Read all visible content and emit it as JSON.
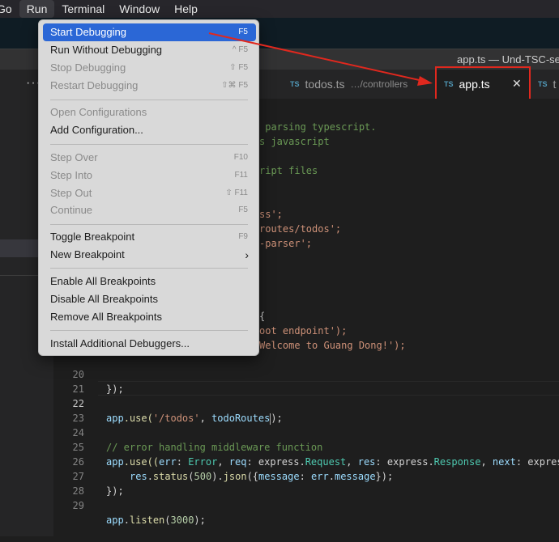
{
  "menubar": {
    "items": [
      "Go",
      "Run",
      "Terminal",
      "Window",
      "Help"
    ],
    "active": "Run"
  },
  "window": {
    "title": "app.ts — Und-TSC-sec"
  },
  "tabs": {
    "todos": {
      "icon": "TS",
      "label": "todos.ts",
      "path": "…/controllers"
    },
    "app": {
      "icon": "TS",
      "label": "app.ts",
      "close": "✕"
    },
    "more": {
      "icon": "TS",
      "label": "t"
    }
  },
  "run_menu": {
    "start_debugging": {
      "label": "Start Debugging",
      "shortcut": "F5"
    },
    "run_without_debugging": {
      "label": "Run Without Debugging",
      "shortcut": "^ F5"
    },
    "stop_debugging": {
      "label": "Stop Debugging",
      "shortcut": "⇧ F5"
    },
    "restart_debugging": {
      "label": "Restart Debugging",
      "shortcut": "⇧⌘ F5"
    },
    "open_configurations": {
      "label": "Open Configurations"
    },
    "add_configuration": {
      "label": "Add Configuration..."
    },
    "step_over": {
      "label": "Step Over",
      "shortcut": "F10"
    },
    "step_into": {
      "label": "Step Into",
      "shortcut": "F11"
    },
    "step_out": {
      "label": "Step Out",
      "shortcut": "⇧ F11"
    },
    "continue": {
      "label": "Continue",
      "shortcut": "F5"
    },
    "toggle_breakpoint": {
      "label": "Toggle Breakpoint",
      "shortcut": "F9"
    },
    "new_breakpoint": {
      "label": "New Breakpoint",
      "submenu": "›"
    },
    "enable_all_breakpoints": {
      "label": "Enable All Breakpoints"
    },
    "disable_all_breakpoints": {
      "label": "Disable All Breakpoints"
    },
    "remove_all_breakpoints": {
      "label": "Remove All Breakpoints"
    },
    "install_additional_debuggers": {
      "label": "Install Additional Debuggers..."
    }
  },
  "editor": {
    "visible_fragments": {
      "f1": " parsing typescript.",
      "f2": "s javascript",
      "f3": "ript files",
      "f4": "ss';",
      "f5": "routes/todos';",
      "f6": "-parser';",
      "f7": "{",
      "f8": "oot endpoint');",
      "f9": "Welcome to Guang Dong!');"
    },
    "line_numbers": [
      "20",
      "21",
      "22",
      "23",
      "24",
      "25",
      "26",
      "27",
      "28",
      "29"
    ],
    "current_line": "22",
    "lines": {
      "l20": "});",
      "l22_a": "app",
      "l22_b": ".use(",
      "l22_c": "'/todos'",
      "l22_d": ", ",
      "l22_e": "todoRoutes",
      "l22_f": ");",
      "l24": "// error handling middleware function",
      "l25_app": "app",
      "l25_use": ".use((",
      "l25_err": "err",
      "l25_c1": ": ",
      "l25_Error": "Error",
      "l25_c2": ", ",
      "l25_req": "req",
      "l25_c3": ": express.",
      "l25_Request": "Request",
      "l25_c4": ", ",
      "l25_res": "res",
      "l25_c5": ": express.",
      "l25_Response": "Response",
      "l25_c6": ", ",
      "l25_next": "next",
      "l25_c7": ": expres",
      "l26_res": "res",
      "l26_a": ".",
      "l26_status": "status",
      "l26_b": "(",
      "l26_500": "500",
      "l26_c": ").",
      "l26_json": "json",
      "l26_d": "({",
      "l26_message": "message",
      "l26_e": ": ",
      "l26_err": "err",
      "l26_f": ".",
      "l26_msg2": "message",
      "l26_g": "});",
      "l27": "});",
      "l29_app": "app",
      "l29_a": ".",
      "l29_listen": "listen",
      "l29_b": "(",
      "l29_3000": "3000",
      "l29_c": ");"
    }
  },
  "colors": {
    "highlight": "#2b67d6",
    "annotation_red": "#e0281e",
    "ts_icon": "#519aba"
  }
}
